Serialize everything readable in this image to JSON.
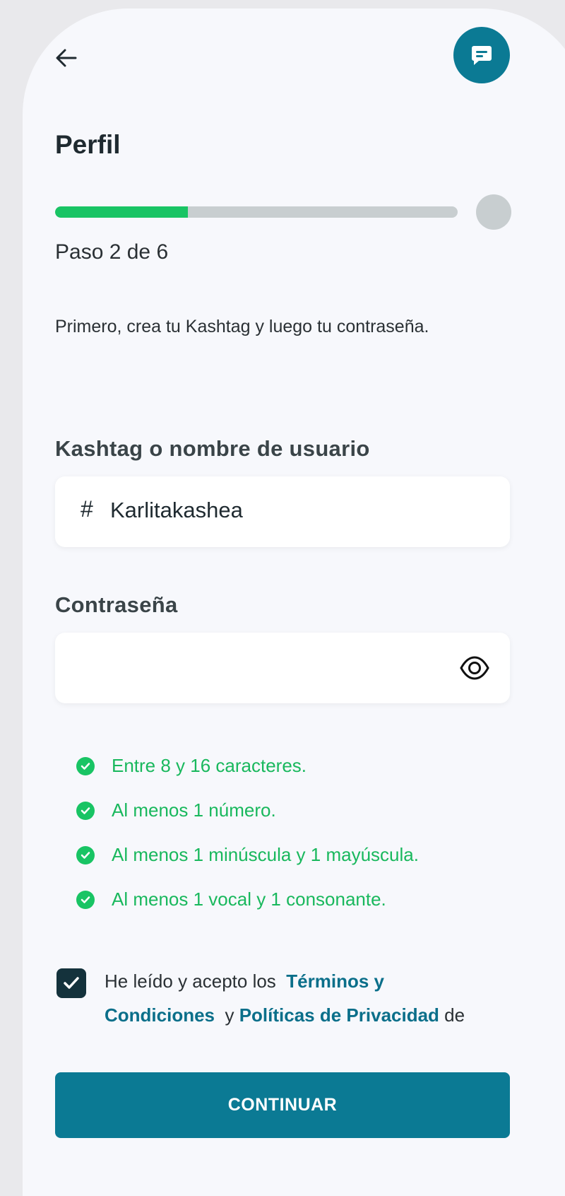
{
  "header": {
    "back_icon": "arrow-left-icon",
    "chat_icon": "chat-message-icon",
    "title": "Perfil"
  },
  "progress": {
    "step_text": "Paso 2 de 6",
    "current_step": 2,
    "total_steps": 6,
    "fraction_filled": 0.33,
    "fill_color": "#19c464",
    "track_color": "#c8ced0"
  },
  "intro": {
    "text": "Primero, crea tu Kashtag y luego tu contraseña."
  },
  "username": {
    "label": "Kashtag o nombre de usuario",
    "prefix": "#",
    "value": "Karlitakashea"
  },
  "password": {
    "label": "Contraseña",
    "value": "",
    "toggle_icon": "eye-icon"
  },
  "rules": [
    {
      "text": "Entre 8 y 16 caracteres."
    },
    {
      "text": "Al menos 1 número."
    },
    {
      "text": "Al menos 1 minúscula y 1 mayúscula."
    },
    {
      "text": "Al menos 1 vocal y 1 consonante."
    }
  ],
  "terms": {
    "checked": true,
    "text_before": "He leído y acepto los",
    "link_terms": "Términos y Condiciones",
    "text_mid": "y",
    "link_privacy": "Políticas de Privacidad",
    "text_after": "de Kash"
  },
  "cta": {
    "label": "CONTINUAR"
  },
  "colors": {
    "primary": "#0b7a94",
    "success": "#19c464",
    "link": "#0b6f8a",
    "checkbox": "#14323c"
  }
}
